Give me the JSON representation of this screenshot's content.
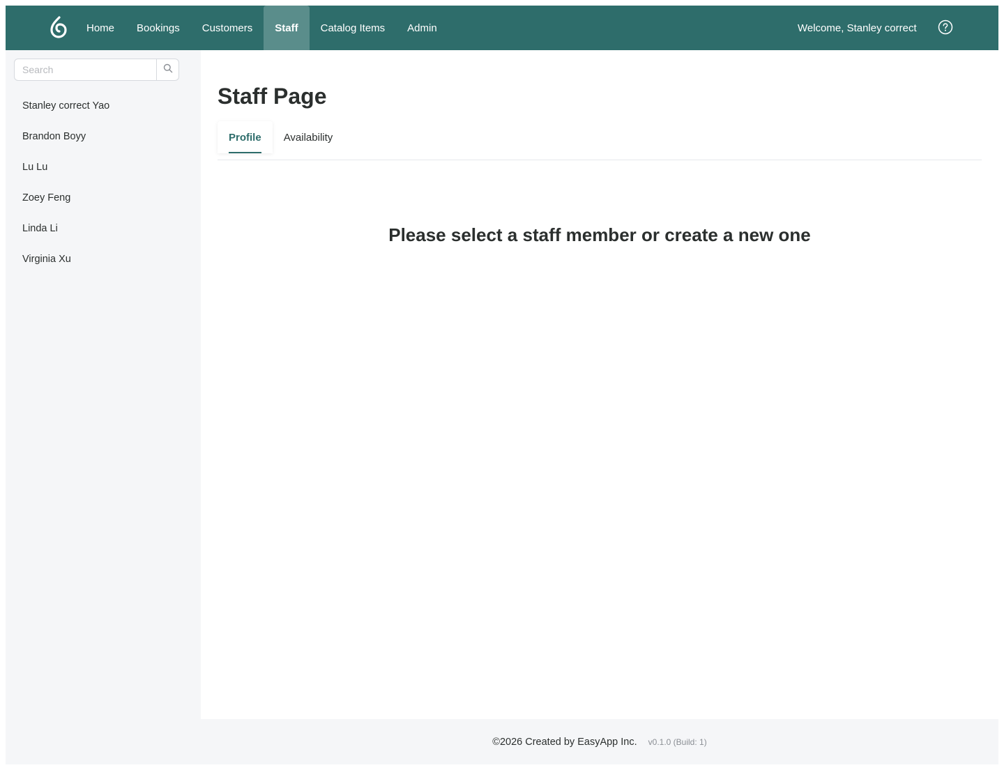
{
  "nav": {
    "logo_icon": "flame-logo-icon",
    "items": [
      {
        "label": "Home"
      },
      {
        "label": "Bookings"
      },
      {
        "label": "Customers"
      },
      {
        "label": "Staff",
        "active": true
      },
      {
        "label": "Catalog Items"
      },
      {
        "label": "Admin"
      }
    ],
    "welcome": "Welcome, Stanley correct",
    "help_icon": "question-circle-icon"
  },
  "sidebar": {
    "search": {
      "placeholder": "Search",
      "value": "",
      "icon": "search-icon"
    },
    "staff": [
      {
        "name": "Stanley correct Yao"
      },
      {
        "name": "Brandon Boyy"
      },
      {
        "name": "Lu Lu"
      },
      {
        "name": "Zoey Feng"
      },
      {
        "name": "Linda Li"
      },
      {
        "name": "Virginia Xu"
      }
    ]
  },
  "main": {
    "title": "Staff Page",
    "tabs": [
      {
        "label": "Profile",
        "active": true
      },
      {
        "label": "Availability"
      }
    ],
    "empty_message": "Please select a staff member or create a new one"
  },
  "footer": {
    "text": "©2026 Created by EasyApp Inc.",
    "version": "v0.1.0 (Build: 1)"
  },
  "colors": {
    "brand": "#2e6d6b",
    "nav_active": "#5a8d8b",
    "sidebar_bg": "#f5f6f8"
  }
}
